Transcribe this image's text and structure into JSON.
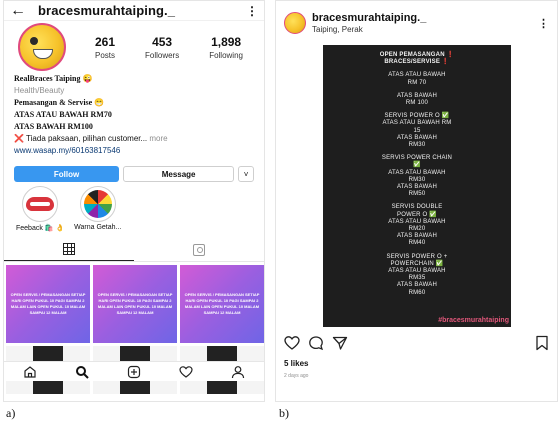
{
  "profile": {
    "username": "bracesmurahtaiping._",
    "stats": [
      {
        "num": "261",
        "label": "Posts"
      },
      {
        "num": "453",
        "label": "Followers"
      },
      {
        "num": "1,898",
        "label": "Following"
      }
    ],
    "bio": {
      "name": "RealBraces Taiping 😜",
      "category": "Health/Beauty",
      "line1": "Pemasangan & Servise 😁",
      "line2": "ATAS ATAU BAWAH RM70",
      "line3": "ATAS BAWAH RM100",
      "note_mark": "❌",
      "note": "Tiada paksaan, pilihan customer...",
      "more": "more",
      "link": "www.wasap.my/60163817546"
    },
    "buttons": {
      "follow": "Follow",
      "message": "Message",
      "chevron": "˅"
    },
    "highlights": [
      {
        "label": "Feeback 🛍️ 👌"
      },
      {
        "label": "Warna Getah..."
      }
    ],
    "post_text": "OPEN SERVIS / PEMASANGAN SETIAP HARI OPEN PUKUL 10 PAGI SAMPAI 2 MALAM LAIN OPEN PUKUL 10 MALAM SAMPAI 12 MALAM",
    "nav_icons": [
      "home-icon",
      "search-icon",
      "add-icon",
      "heart-icon",
      "profile-icon"
    ],
    "panel_label": "a)"
  },
  "post": {
    "username": "bracesmurahtaiping._",
    "location": "Taiping, Perak",
    "poster": [
      {
        "text": "OPEN PEMASANGAN ❗",
        "bold": true
      },
      {
        "text": "BRACES/SERVISE ❗",
        "bold": true
      },
      {
        "text": "ATAS ATAU BAWAH",
        "gap": true
      },
      {
        "text": "RM 70"
      },
      {
        "text": "ATAS BAWAH",
        "gap": true
      },
      {
        "text": "RM 100"
      },
      {
        "text": "SERVIS POWER O ✅",
        "gap": true
      },
      {
        "text": "ATAS ATAU BAWAH RM"
      },
      {
        "text": "15"
      },
      {
        "text": "ATAS BAWAH"
      },
      {
        "text": "RM30"
      },
      {
        "text": "SERVIS POWER CHAIN",
        "gap": true
      },
      {
        "text": "✅"
      },
      {
        "text": "ATAS ATAU BAWAH"
      },
      {
        "text": "RM30"
      },
      {
        "text": "ATAS BAWAH"
      },
      {
        "text": "RM50"
      },
      {
        "text": "SERVIS DOUBLE",
        "gap": true
      },
      {
        "text": "POWER O ✅"
      },
      {
        "text": "ATAS ATAU BAWAH"
      },
      {
        "text": "RM20"
      },
      {
        "text": "ATAS BAWAH"
      },
      {
        "text": "RM40"
      },
      {
        "text": "SERVIS POWER O +",
        "gap": true
      },
      {
        "text": "POWERCHAIN ✅"
      },
      {
        "text": "ATAS ATAU BAWAH"
      },
      {
        "text": "RM35"
      },
      {
        "text": "ATAS BAWAH"
      },
      {
        "text": "RM60"
      }
    ],
    "hashtag": "#bracesmurahtaiping",
    "likes": "5 likes",
    "date": "2 days ago",
    "panel_label": "b)"
  }
}
